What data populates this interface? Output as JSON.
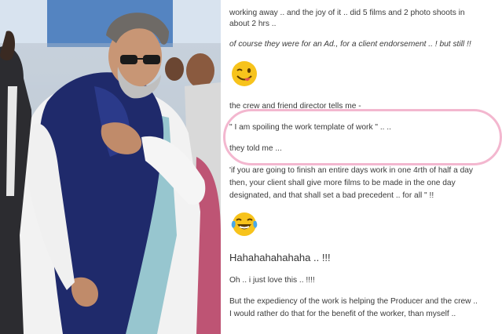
{
  "post": {
    "p1_line1": "working away .. and the joy of it .. did 5 films and 2 photo shoots in",
    "p1_line2": "about 2 hrs ..",
    "p2": "of course they were for an Ad., for a client endorsement .. ! but still !!",
    "p3": "the crew and friend director tells me -",
    "quote": "\" I am spoiling the work template of work \" .. ..",
    "they_told": "they told me  ...",
    "p4_line1": "'if you are going to finish an entire days work in one 4rth of half a day",
    "p4_line2": "then, your client shall give more films to be made in the one day",
    "p4_line3": "designated, and that shall set a bad precedent .. for all \" !!",
    "laugh": "Hahahahahahaha .. !!!",
    "p5": "Oh .. i just love this .. !!!!",
    "p6_line1": "But the expediency of the work is helping the Producer and the crew ..",
    "p6_line2": "I would rather do that for the benefit of the worker, than myself .."
  },
  "icons": {
    "emoji1": "winking-tongue-emoji-icon",
    "emoji2": "tears-of-joy-emoji-icon"
  },
  "colors": {
    "highlight": "#f3b7cf",
    "scarf": "#1f2a6b",
    "emoji_yellow": "#f7c31c"
  }
}
